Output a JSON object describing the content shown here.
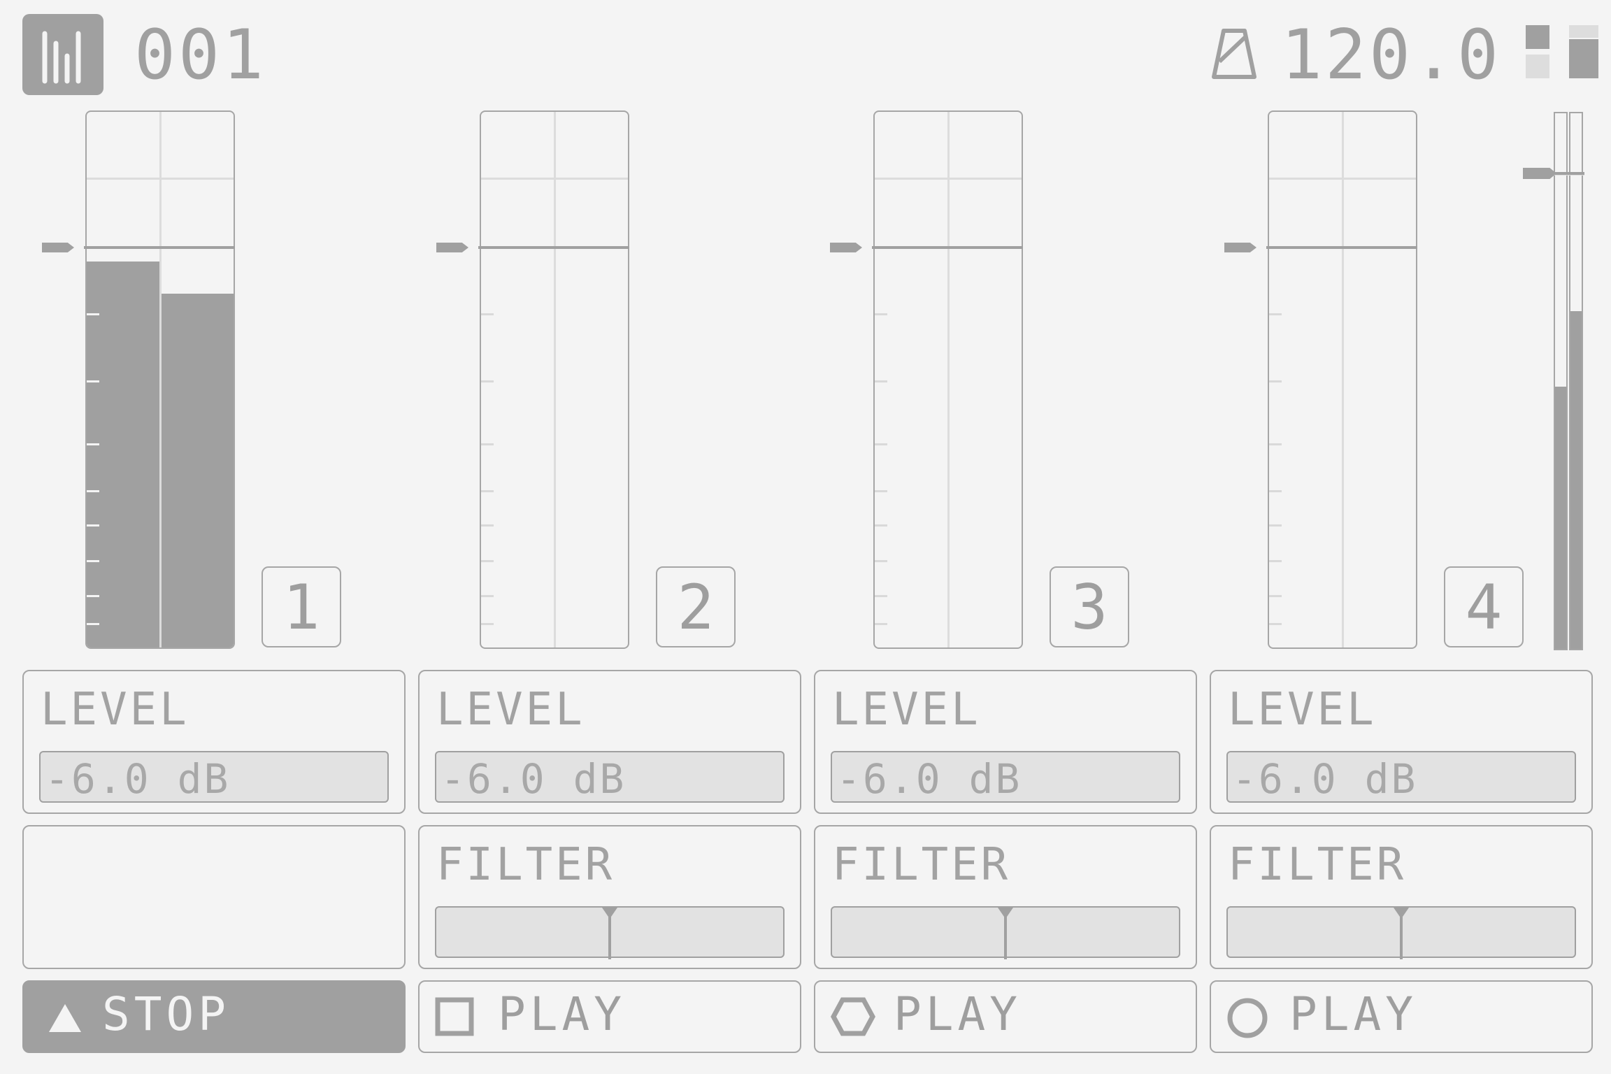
{
  "header": {
    "pattern_number": "001",
    "tempo": "120.0",
    "logo_icon": "mixer-bars-icon",
    "metronome_icon": "metronome-icon"
  },
  "channels": [
    {
      "number": "1",
      "level_label": "LEVEL",
      "level_value": "-6.0 dB",
      "filter_label": "",
      "play_label": "STOP",
      "play_icon": "triangle-icon",
      "meter_left": 0.72,
      "meter_right": 0.66
    },
    {
      "number": "2",
      "level_label": "LEVEL",
      "level_value": "-6.0 dB",
      "filter_label": "FILTER",
      "play_label": "PLAY",
      "play_icon": "square-icon",
      "meter_left": 0,
      "meter_right": 0
    },
    {
      "number": "3",
      "level_label": "LEVEL",
      "level_value": "-6.0 dB",
      "filter_label": "FILTER",
      "play_label": "PLAY",
      "play_icon": "hexagon-icon",
      "meter_left": 0,
      "meter_right": 0
    },
    {
      "number": "4",
      "level_label": "LEVEL",
      "level_value": "-6.0 dB",
      "filter_label": "FILTER",
      "play_label": "PLAY",
      "play_icon": "circle-icon",
      "meter_left": 0,
      "meter_right": 0
    }
  ],
  "master": {
    "meter_left": 0.49,
    "meter_right": 0.63
  },
  "colors": {
    "background": "#f4f4f4",
    "accent": "#a0a0a0",
    "field": "#e2e2e2",
    "grid": "#dcdcdc"
  }
}
